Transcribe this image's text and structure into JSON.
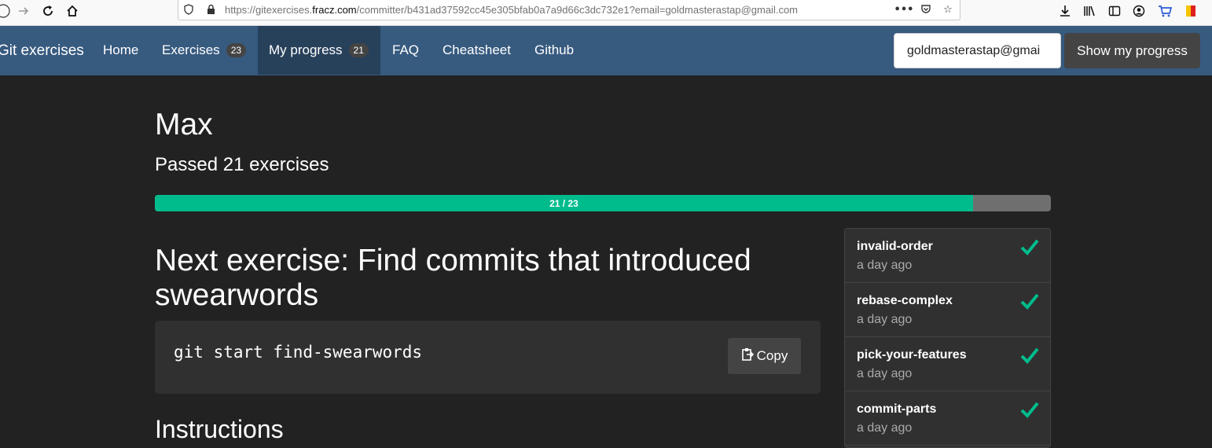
{
  "browser": {
    "url_prefix": "https://gitexercises.",
    "url_domain": "fracz.com",
    "url_path": "/committer/b431ad37592cc45e305bfab0a7a9d66c3dc732e1?email=goldmasterastap@gmail.com",
    "icons": [
      "back-icon",
      "forward-icon",
      "reload-icon",
      "home-icon",
      "shield-icon",
      "lock-icon",
      "more-icon",
      "pocket-icon",
      "star-icon",
      "download-icon",
      "library-icon",
      "sidebar-icon",
      "account-icon",
      "cart-icon",
      "flag-icon"
    ]
  },
  "navbar": {
    "brand": "Git exercises",
    "items": [
      {
        "label": "Home"
      },
      {
        "label": "Exercises",
        "badge": "23"
      },
      {
        "label": "My progress",
        "badge": "21",
        "active": true
      },
      {
        "label": "FAQ"
      },
      {
        "label": "Cheatsheet"
      },
      {
        "label": "Github"
      }
    ],
    "email_value": "goldmasterastap@gmai",
    "show_button": "Show my progress",
    "colors": {
      "bar": "#375a7f",
      "active": "#28415b"
    }
  },
  "profile": {
    "name": "Max",
    "passed_text": "Passed 21 exercises",
    "progress_label": "21 / 23",
    "passed": 21,
    "total": 23
  },
  "next_exercise": {
    "title": "Next exercise: Find commits that introduced swearwords",
    "command": "git start find-swearwords",
    "copy_label": "Copy"
  },
  "instructions_heading": "Instructions",
  "exercises_done": [
    {
      "name": "invalid-order",
      "time": "a day ago"
    },
    {
      "name": "rebase-complex",
      "time": "a day ago"
    },
    {
      "name": "pick-your-features",
      "time": "a day ago"
    },
    {
      "name": "commit-parts",
      "time": "a day ago"
    }
  ],
  "colors": {
    "accent": "#00bc8c",
    "background": "#222222",
    "panel": "#303030"
  }
}
